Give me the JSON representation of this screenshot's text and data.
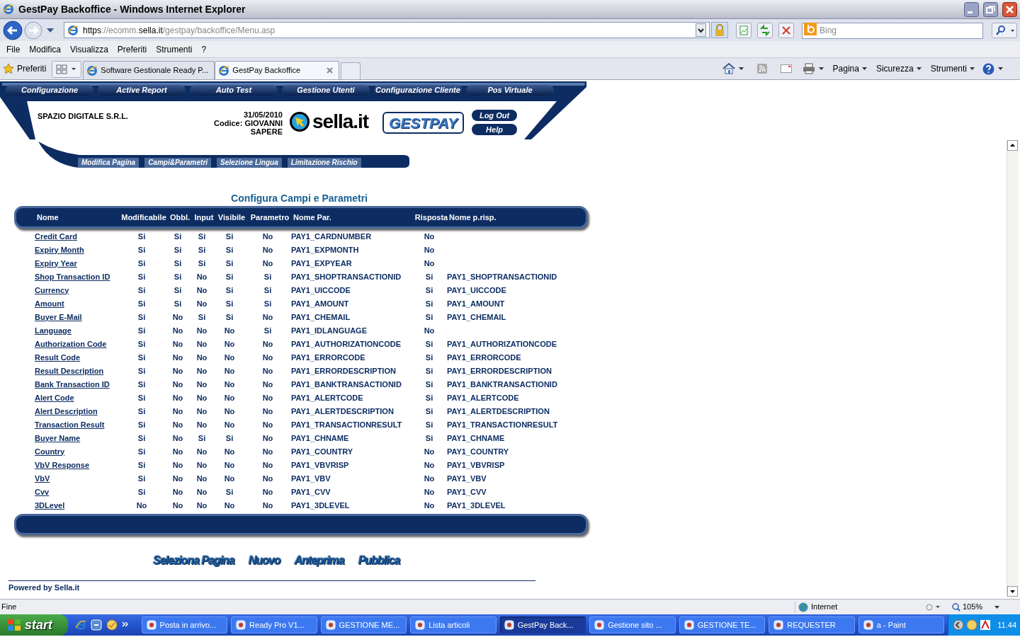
{
  "window": {
    "title": "GestPay Backoffice - Windows Internet Explorer"
  },
  "address_bar": {
    "url_parts": [
      {
        "text": "https",
        "emphasis": true
      },
      {
        "text": "://ecomm.",
        "emphasis": false
      },
      {
        "text": "sella.it",
        "emphasis": true
      },
      {
        "text": "/gestpay/backoffice/Menu.asp",
        "emphasis": false
      }
    ]
  },
  "search": {
    "placeholder": "Bing"
  },
  "menu": [
    "File",
    "Modifica",
    "Visualizza",
    "Preferiti",
    "Strumenti",
    "?"
  ],
  "favorites": {
    "label": "Preferiti"
  },
  "tabs": [
    {
      "label": "Software Gestionale Ready P...",
      "selected": false
    },
    {
      "label": "GestPay Backoffice",
      "selected": true
    }
  ],
  "command_bar": [
    "Pagina",
    "Sicurezza",
    "Strumenti"
  ],
  "site": {
    "nav": [
      "Configurazione",
      "Active Report",
      "Auto Test",
      "Gestione Utenti",
      "Configurazione Cliente",
      "Pos Virtuale"
    ],
    "company": "SPAZIO DIGITALE S.R.L.",
    "date": "31/05/2010",
    "code_lines": [
      "Codice: GIOVANNI",
      "SAPERE"
    ],
    "logo_text": "sella.it",
    "brand": "GESTPAY",
    "header_buttons": [
      "Log Out",
      "Help"
    ],
    "subnav": [
      "Modifica Pagina",
      "Campi&Parametri",
      "Selezione Lingua",
      "Limitazione Rischio"
    ]
  },
  "page": {
    "title": "Configura Campi e Parametri",
    "columns": [
      "Nome",
      "Modificabile",
      "Obbl.",
      "Input",
      "Visibile",
      "Parametro",
      "Nome Par.",
      "Risposta",
      "Nome p.risp."
    ],
    "rows": [
      {
        "cells": [
          "Credit Card",
          "Si",
          "Si",
          "Si",
          "Si",
          "No",
          "PAY1_CARDNUMBER",
          "No"
        ]
      },
      {
        "cells": [
          "Expiry Month",
          "Si",
          "Si",
          "Si",
          "Si",
          "No",
          "PAY1_EXPMONTH",
          "No"
        ]
      },
      {
        "cells": [
          "Expiry Year",
          "Si",
          "Si",
          "Si",
          "Si",
          "No",
          "PAY1_EXPYEAR",
          "No"
        ]
      },
      {
        "cells": [
          "Shop Transaction ID",
          "Si",
          "Si",
          "No",
          "Si",
          "Si",
          "PAY1_SHOPTRANSACTIONID",
          "Si",
          "PAY1_SHOPTRANSACTIONID"
        ]
      },
      {
        "cells": [
          "Currency",
          "Si",
          "Si",
          "No",
          "Si",
          "Si",
          "PAY1_UICCODE",
          "Si",
          "PAY1_UICCODE"
        ]
      },
      {
        "cells": [
          "Amount",
          "Si",
          "Si",
          "No",
          "Si",
          "Si",
          "PAY1_AMOUNT",
          "Si",
          "PAY1_AMOUNT"
        ]
      },
      {
        "cells": [
          "Buyer E-Mail",
          "Si",
          "No",
          "Si",
          "Si",
          "No",
          "PAY1_CHEMAIL",
          "Si",
          "PAY1_CHEMAIL"
        ]
      },
      {
        "cells": [
          "Language",
          "Si",
          "No",
          "No",
          "No",
          "Si",
          "PAY1_IDLANGUAGE",
          "No"
        ]
      },
      {
        "cells": [
          "Authorization Code",
          "Si",
          "No",
          "No",
          "No",
          "No",
          "PAY1_AUTHORIZATIONCODE",
          "Si",
          "PAY1_AUTHORIZATIONCODE"
        ]
      },
      {
        "cells": [
          "Result Code",
          "Si",
          "No",
          "No",
          "No",
          "No",
          "PAY1_ERRORCODE",
          "Si",
          "PAY1_ERRORCODE"
        ]
      },
      {
        "cells": [
          "Result Description",
          "Si",
          "No",
          "No",
          "No",
          "No",
          "PAY1_ERRORDESCRIPTION",
          "Si",
          "PAY1_ERRORDESCRIPTION"
        ]
      },
      {
        "cells": [
          "Bank Transaction ID",
          "Si",
          "No",
          "No",
          "No",
          "No",
          "PAY1_BANKTRANSACTIONID",
          "Si",
          "PAY1_BANKTRANSACTIONID"
        ]
      },
      {
        "cells": [
          "Alert Code",
          "Si",
          "No",
          "No",
          "No",
          "No",
          "PAY1_ALERTCODE",
          "Si",
          "PAY1_ALERTCODE"
        ]
      },
      {
        "cells": [
          "Alert Description",
          "Si",
          "No",
          "No",
          "No",
          "No",
          "PAY1_ALERTDESCRIPTION",
          "Si",
          "PAY1_ALERTDESCRIPTION"
        ]
      },
      {
        "cells": [
          "Transaction Result",
          "Si",
          "No",
          "No",
          "No",
          "No",
          "PAY1_TRANSACTIONRESULT",
          "Si",
          "PAY1_TRANSACTIONRESULT"
        ]
      },
      {
        "cells": [
          "Buyer Name",
          "Si",
          "No",
          "Si",
          "Si",
          "No",
          "PAY1_CHNAME",
          "Si",
          "PAY1_CHNAME"
        ]
      },
      {
        "cells": [
          "Country",
          "Si",
          "No",
          "No",
          "No",
          "No",
          "PAY1_COUNTRY",
          "No",
          "PAY1_COUNTRY"
        ]
      },
      {
        "cells": [
          "VbV Response",
          "Si",
          "No",
          "No",
          "No",
          "No",
          "PAY1_VBVRISP",
          "No",
          "PAY1_VBVRISP"
        ]
      },
      {
        "cells": [
          "VbV",
          "Si",
          "No",
          "No",
          "No",
          "No",
          "PAY1_VBV",
          "No",
          "PAY1_VBV"
        ]
      },
      {
        "cells": [
          "Cvv",
          "Si",
          "No",
          "No",
          "Si",
          "No",
          "PAY1_CVV",
          "No",
          "PAY1_CVV"
        ]
      },
      {
        "cells": [
          "3DLevel",
          "No",
          "No",
          "No",
          "No",
          "No",
          "PAY1_3DLEVEL",
          "No",
          "PAY1_3DLEVEL"
        ]
      }
    ],
    "actions": [
      "Seleziona Pagina",
      "Nuovo",
      "Anteprima",
      "Pubblica"
    ],
    "footer": "Powered by Sella.it"
  },
  "status_bar": {
    "text": "Fine",
    "zone": "Internet",
    "zoom": "105%"
  },
  "taskbar": {
    "start": "start",
    "items": [
      {
        "label": "Posta in arrivo...",
        "selected": false
      },
      {
        "label": "Ready Pro V1...",
        "selected": false
      },
      {
        "label": "GESTIONE ME...",
        "selected": false
      },
      {
        "label": "Lista articoli",
        "selected": false
      },
      {
        "label": "GestPay Back...",
        "selected": true
      },
      {
        "label": "Gestione sito ...",
        "selected": false
      },
      {
        "label": "GESTIONE TE...",
        "selected": false
      },
      {
        "label": "REQUESTER",
        "selected": false
      },
      {
        "label": "a - Paint",
        "selected": false
      }
    ],
    "clock": "11.44"
  }
}
